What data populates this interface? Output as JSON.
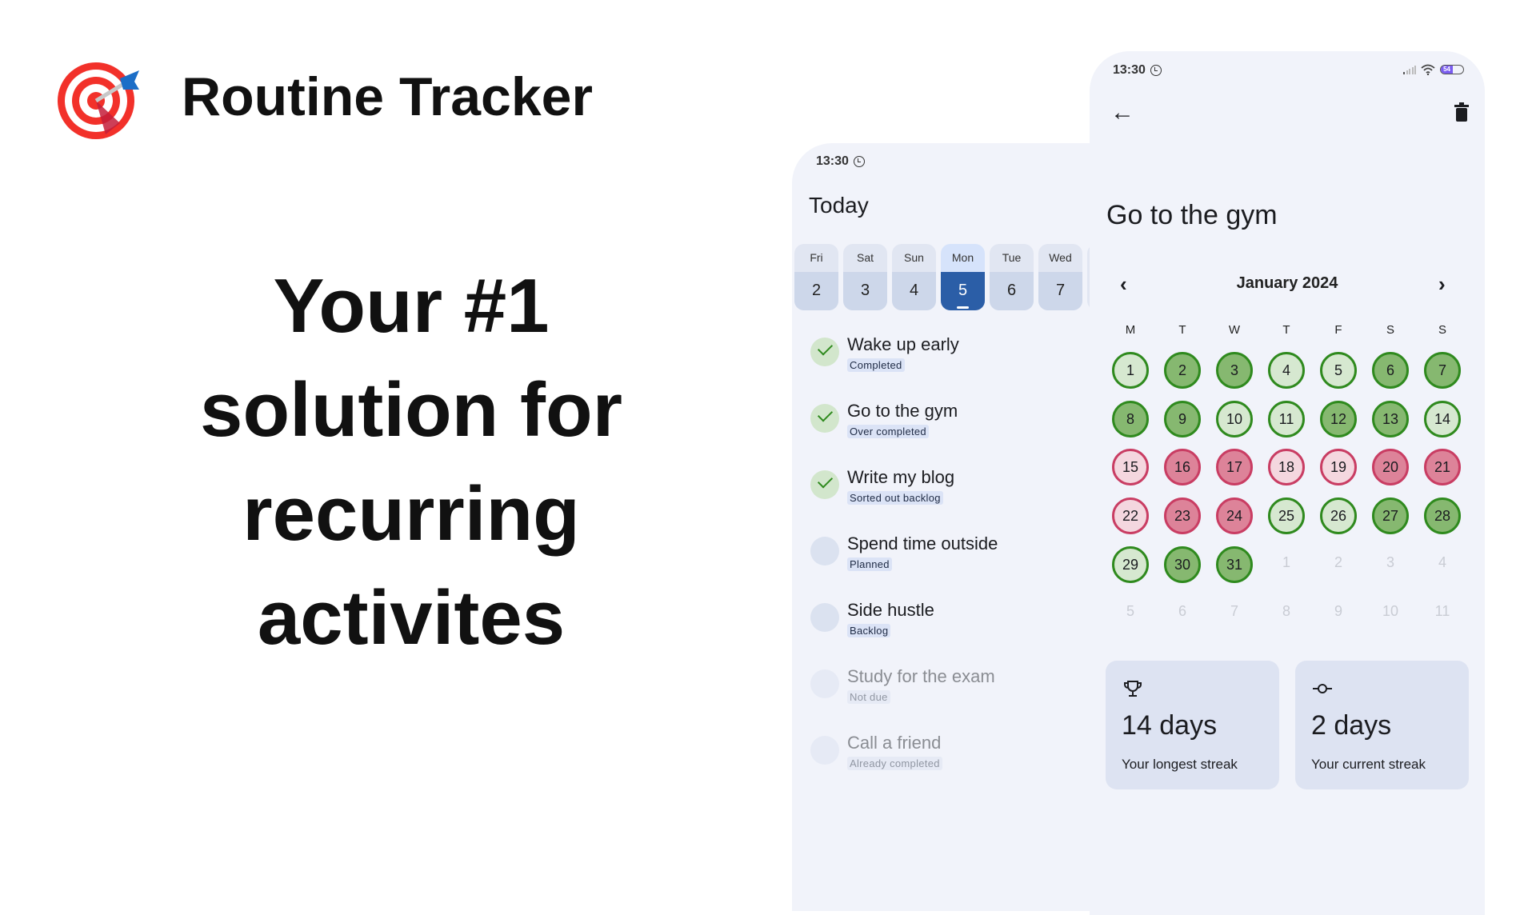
{
  "brand": {
    "title": "Routine Tracker",
    "logo": "target-dart-icon"
  },
  "headline": {
    "lines": [
      "Your #1",
      "solution for",
      "recurring",
      "activites"
    ]
  },
  "today_screen": {
    "status_time": "13:30",
    "title": "Today",
    "dates": [
      {
        "weekday": "Fri",
        "day": "2"
      },
      {
        "weekday": "Sat",
        "day": "3"
      },
      {
        "weekday": "Sun",
        "day": "4"
      },
      {
        "weekday": "Mon",
        "day": "5",
        "selected": true
      },
      {
        "weekday": "Tue",
        "day": "6"
      },
      {
        "weekday": "Wed",
        "day": "7"
      }
    ],
    "items": [
      {
        "title": "Wake up early",
        "status": "Completed",
        "checked": true
      },
      {
        "title": "Go to the gym",
        "status": "Over completed",
        "checked": true
      },
      {
        "title": "Write my blog",
        "status": "Sorted out backlog",
        "checked": true
      },
      {
        "title": "Spend time outside",
        "status": "Planned",
        "checked": false
      },
      {
        "title": "Side hustle",
        "status": "Backlog",
        "checked": false
      },
      {
        "title": "Study for the exam",
        "status": "Not due",
        "checked": false,
        "dimmed": true
      },
      {
        "title": "Call a friend",
        "status": "Already completed",
        "checked": false,
        "dimmed": true
      }
    ]
  },
  "detail_screen": {
    "status_time": "13:30",
    "battery": "54",
    "title": "Go to the gym",
    "month": "January 2024",
    "weekdays": [
      "M",
      "T",
      "W",
      "T",
      "F",
      "S",
      "S"
    ],
    "colors": {
      "green_border": "#2f8a1e",
      "green_light": "#d6e8d0",
      "green_dark": "#86b870",
      "red_border": "#c93d63",
      "red_light": "#f4d7df",
      "red_dark": "#dd8399"
    },
    "days": [
      {
        "d": "1",
        "s": "light-green"
      },
      {
        "d": "2",
        "s": "dark-green"
      },
      {
        "d": "3",
        "s": "dark-green"
      },
      {
        "d": "4",
        "s": "light-green"
      },
      {
        "d": "5",
        "s": "light-green"
      },
      {
        "d": "6",
        "s": "dark-green"
      },
      {
        "d": "7",
        "s": "dark-green"
      },
      {
        "d": "8",
        "s": "dark-green"
      },
      {
        "d": "9",
        "s": "dark-green"
      },
      {
        "d": "10",
        "s": "light-green"
      },
      {
        "d": "11",
        "s": "light-green"
      },
      {
        "d": "12",
        "s": "dark-green"
      },
      {
        "d": "13",
        "s": "dark-green"
      },
      {
        "d": "14",
        "s": "light-green"
      },
      {
        "d": "15",
        "s": "light-red"
      },
      {
        "d": "16",
        "s": "dark-red"
      },
      {
        "d": "17",
        "s": "dark-red"
      },
      {
        "d": "18",
        "s": "light-red"
      },
      {
        "d": "19",
        "s": "light-red"
      },
      {
        "d": "20",
        "s": "dark-red"
      },
      {
        "d": "21",
        "s": "dark-red"
      },
      {
        "d": "22",
        "s": "light-red"
      },
      {
        "d": "23",
        "s": "dark-red"
      },
      {
        "d": "24",
        "s": "dark-red"
      },
      {
        "d": "25",
        "s": "light-green"
      },
      {
        "d": "26",
        "s": "light-green"
      },
      {
        "d": "27",
        "s": "dark-green"
      },
      {
        "d": "28",
        "s": "dark-green"
      },
      {
        "d": "29",
        "s": "light-green"
      },
      {
        "d": "30",
        "s": "dark-green"
      },
      {
        "d": "31",
        "s": "dark-green"
      },
      {
        "d": "1",
        "s": "outside"
      },
      {
        "d": "2",
        "s": "outside"
      },
      {
        "d": "3",
        "s": "outside"
      },
      {
        "d": "4",
        "s": "outside"
      },
      {
        "d": "5",
        "s": "outside"
      },
      {
        "d": "6",
        "s": "outside"
      },
      {
        "d": "7",
        "s": "outside"
      },
      {
        "d": "8",
        "s": "outside"
      },
      {
        "d": "9",
        "s": "outside"
      },
      {
        "d": "10",
        "s": "outside"
      },
      {
        "d": "11",
        "s": "outside"
      }
    ],
    "streaks": [
      {
        "icon": "trophy-icon",
        "value": "14 days",
        "label": "Your longest streak"
      },
      {
        "icon": "commit-icon",
        "value": "2 days",
        "label": "Your current streak"
      }
    ]
  }
}
